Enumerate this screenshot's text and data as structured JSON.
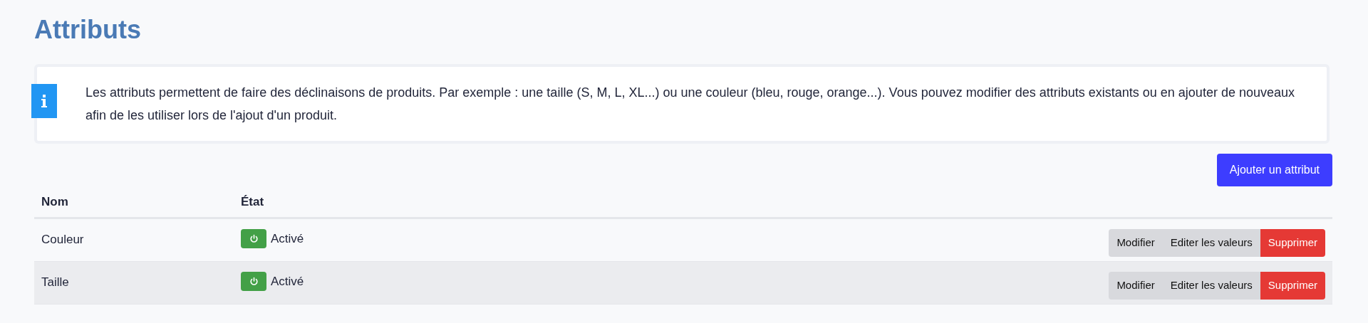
{
  "title": "Attributs",
  "info": {
    "text": "Les attributs permettent de faire des déclinaisons de produits. Par exemple : une taille (S, M, L, XL...) ou une couleur (bleu, rouge, orange...). Vous pouvez modifier des attributs existants ou en ajouter de nouveaux afin de les utiliser lors de l'ajout d'un produit."
  },
  "add_button": "Ajouter un attribut",
  "table": {
    "columns": [
      "Nom",
      "État"
    ],
    "rows": [
      {
        "name": "Couleur",
        "active": true,
        "state": "Activé",
        "actions": [
          {
            "kind": "neutral",
            "label": "Modifier"
          },
          {
            "kind": "neutral",
            "label": "Editer les valeurs"
          },
          {
            "kind": "danger",
            "label": "Supprimer"
          }
        ]
      },
      {
        "name": "Taille",
        "active": true,
        "state": "Activé",
        "actions": [
          {
            "kind": "neutral",
            "label": "Modifier"
          },
          {
            "kind": "neutral",
            "label": "Editer les valeurs"
          },
          {
            "kind": "danger",
            "label": "Supprimer"
          }
        ]
      }
    ]
  }
}
